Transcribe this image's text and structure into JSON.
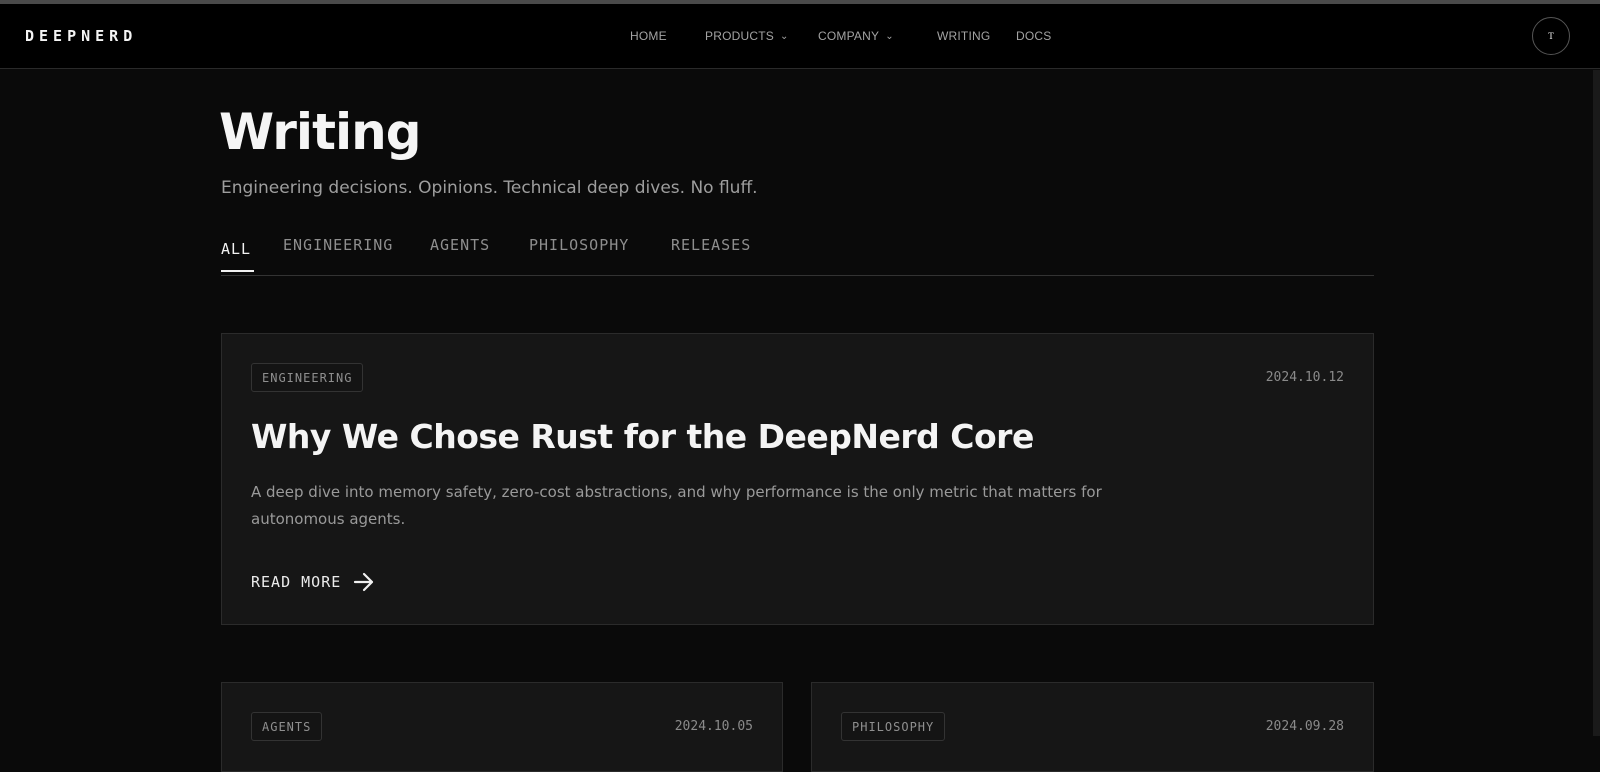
{
  "header": {
    "logo": "DEEPNERD",
    "nav": {
      "home": "HOME",
      "products": "PRODUCTS",
      "company": "COMPANY",
      "writing": "WRITING",
      "docs": "DOCS"
    },
    "avatar_text": "T"
  },
  "page": {
    "title": "Writing",
    "subtitle": "Engineering decisions. Opinions. Technical deep dives. No fluff."
  },
  "tabs": [
    "ALL",
    "ENGINEERING",
    "AGENTS",
    "PHILOSOPHY",
    "RELEASES"
  ],
  "featured": {
    "tag": "ENGINEERING",
    "date": "2024.10.12",
    "title": "Why We Chose Rust for the DeepNerd Core",
    "excerpt": "A deep dive into memory safety, zero-cost abstractions, and why performance is the only metric that matters for autonomous agents.",
    "cta": "READ MORE"
  },
  "posts": [
    {
      "tag": "AGENTS",
      "date": "2024.10.05"
    },
    {
      "tag": "PHILOSOPHY",
      "date": "2024.09.28"
    }
  ]
}
